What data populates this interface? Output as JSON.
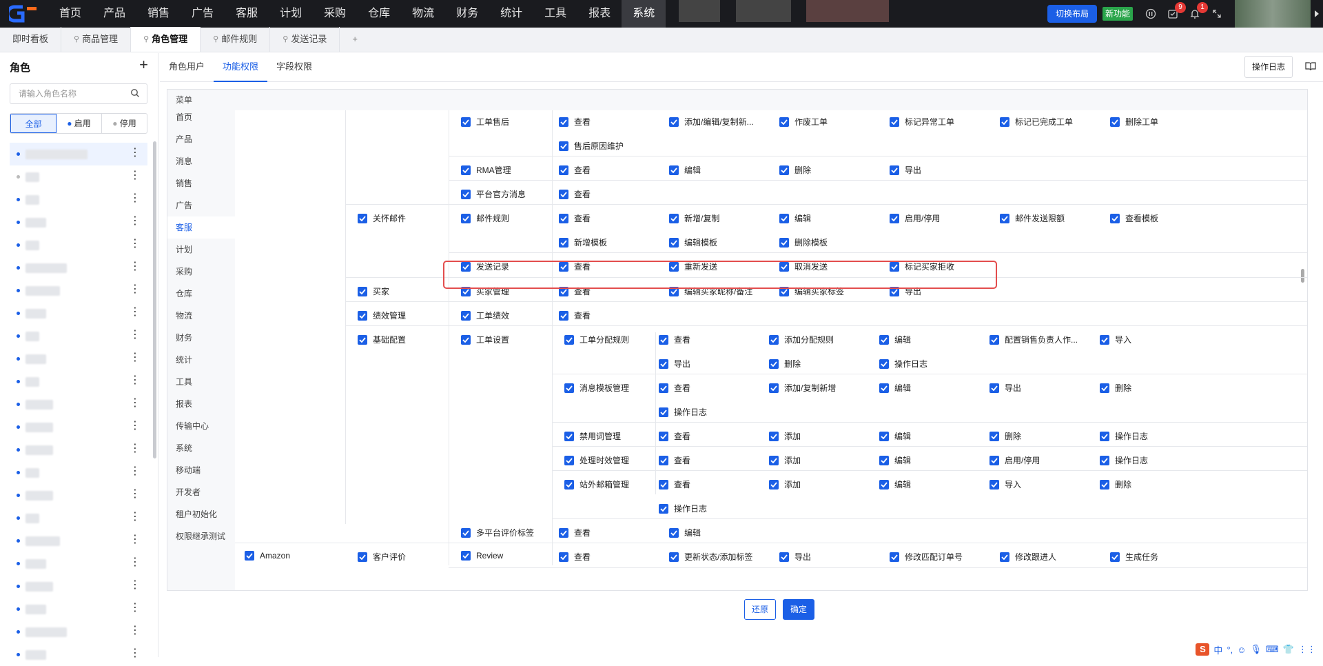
{
  "topnav": {
    "items": [
      "首页",
      "产品",
      "销售",
      "广告",
      "客服",
      "计划",
      "采购",
      "仓库",
      "物流",
      "财务",
      "统计",
      "工具",
      "报表",
      "系统"
    ],
    "active": "系统",
    "switch_layout": "切换布局",
    "new_feature": "新功能",
    "badge_tasks": "9",
    "badge_bell": "1"
  },
  "page_tabs": [
    {
      "label": "即时看板"
    },
    {
      "label": "商品管理"
    },
    {
      "label": "角色管理",
      "active": true
    },
    {
      "label": "邮件规则"
    },
    {
      "label": "发送记录"
    },
    {
      "label": "+"
    }
  ],
  "sidebar": {
    "title": "角色",
    "add": "+",
    "search_placeholder": "请输入角色名称",
    "filters": [
      "全部",
      "启用",
      "停用"
    ],
    "active_filter": "全部",
    "more": "⋮"
  },
  "subtabs": [
    "角色用户",
    "功能权限",
    "字段权限"
  ],
  "active_subtab": "功能权限",
  "op_log": "操作日志",
  "menu": {
    "header": "菜单",
    "items": [
      "首页",
      "产品",
      "消息",
      "销售",
      "广告",
      "客服",
      "计划",
      "采购",
      "仓库",
      "物流",
      "财务",
      "统计",
      "工具",
      "报表",
      "传输中心",
      "系统",
      "移动端",
      "开发者",
      "租户初始化",
      "权限继承测试"
    ],
    "active": "客服"
  },
  "permissions": {
    "r1": {
      "l3": "工单售后",
      "p": [
        "查看",
        "添加/编辑/复制新...",
        "作废工单",
        "标记异常工单",
        "标记已完成工单",
        "删除工单",
        "售后原因维护"
      ]
    },
    "r2": {
      "l3": "RMA管理",
      "p": [
        "查看",
        "编辑",
        "删除",
        "导出"
      ]
    },
    "r3": {
      "l3": "平台官方消息",
      "p": [
        "查看"
      ]
    },
    "r4": {
      "l2": "关怀邮件",
      "l3": "邮件规则",
      "p": [
        "查看",
        "新增/复制",
        "编辑",
        "启用/停用",
        "邮件发送限额",
        "查看模板",
        "新增模板",
        "编辑模板",
        "删除模板"
      ]
    },
    "r5": {
      "l3": "发送记录",
      "p": [
        "查看",
        "重新发送",
        "取消发送",
        "标记买家拒收"
      ]
    },
    "r6": {
      "l2": "买家",
      "l3": "买家管理",
      "p": [
        "查看",
        "编辑买家昵称/备注",
        "编辑买家标签",
        "导出"
      ]
    },
    "r7": {
      "l2": "绩效管理",
      "l3": "工单绩效",
      "p": [
        "查看"
      ]
    },
    "r8": {
      "l2": "基础配置",
      "l3": "工单设置",
      "l4": "工单分配规则",
      "p": [
        "查看",
        "添加分配规则",
        "编辑",
        "配置销售负责人作...",
        "导入",
        "导出",
        "删除",
        "操作日志"
      ]
    },
    "r9": {
      "l4": "消息模板管理",
      "p": [
        "查看",
        "添加/复制新增",
        "编辑",
        "导出",
        "删除",
        "操作日志"
      ]
    },
    "r10": {
      "l4": "禁用词管理",
      "p": [
        "查看",
        "添加",
        "编辑",
        "删除",
        "操作日志"
      ]
    },
    "r11": {
      "l4": "处理时效管理",
      "p": [
        "查看",
        "添加",
        "编辑",
        "启用/停用",
        "操作日志"
      ]
    },
    "r12": {
      "l4": "站外邮箱管理",
      "p": [
        "查看",
        "添加",
        "编辑",
        "导入",
        "删除",
        "操作日志"
      ]
    },
    "r13": {
      "l3": "多平台评价标签",
      "p": [
        "查看",
        "编辑"
      ]
    },
    "r14": {
      "l1": "Amazon",
      "l2": "客户评价",
      "l3": "Review",
      "p": [
        "查看",
        "更新状态/添加标签",
        "导出",
        "修改匹配订单号",
        "修改跟进人",
        "生成任务"
      ]
    }
  },
  "footer": {
    "reset": "还原",
    "confirm": "确定"
  },
  "ime": {
    "logo": "S",
    "lang": "中"
  },
  "colors": {
    "primary": "#1b5fe6",
    "topbar": "#1a1b1f",
    "highlight": "#e34d4d",
    "new": "#2aa54b"
  }
}
